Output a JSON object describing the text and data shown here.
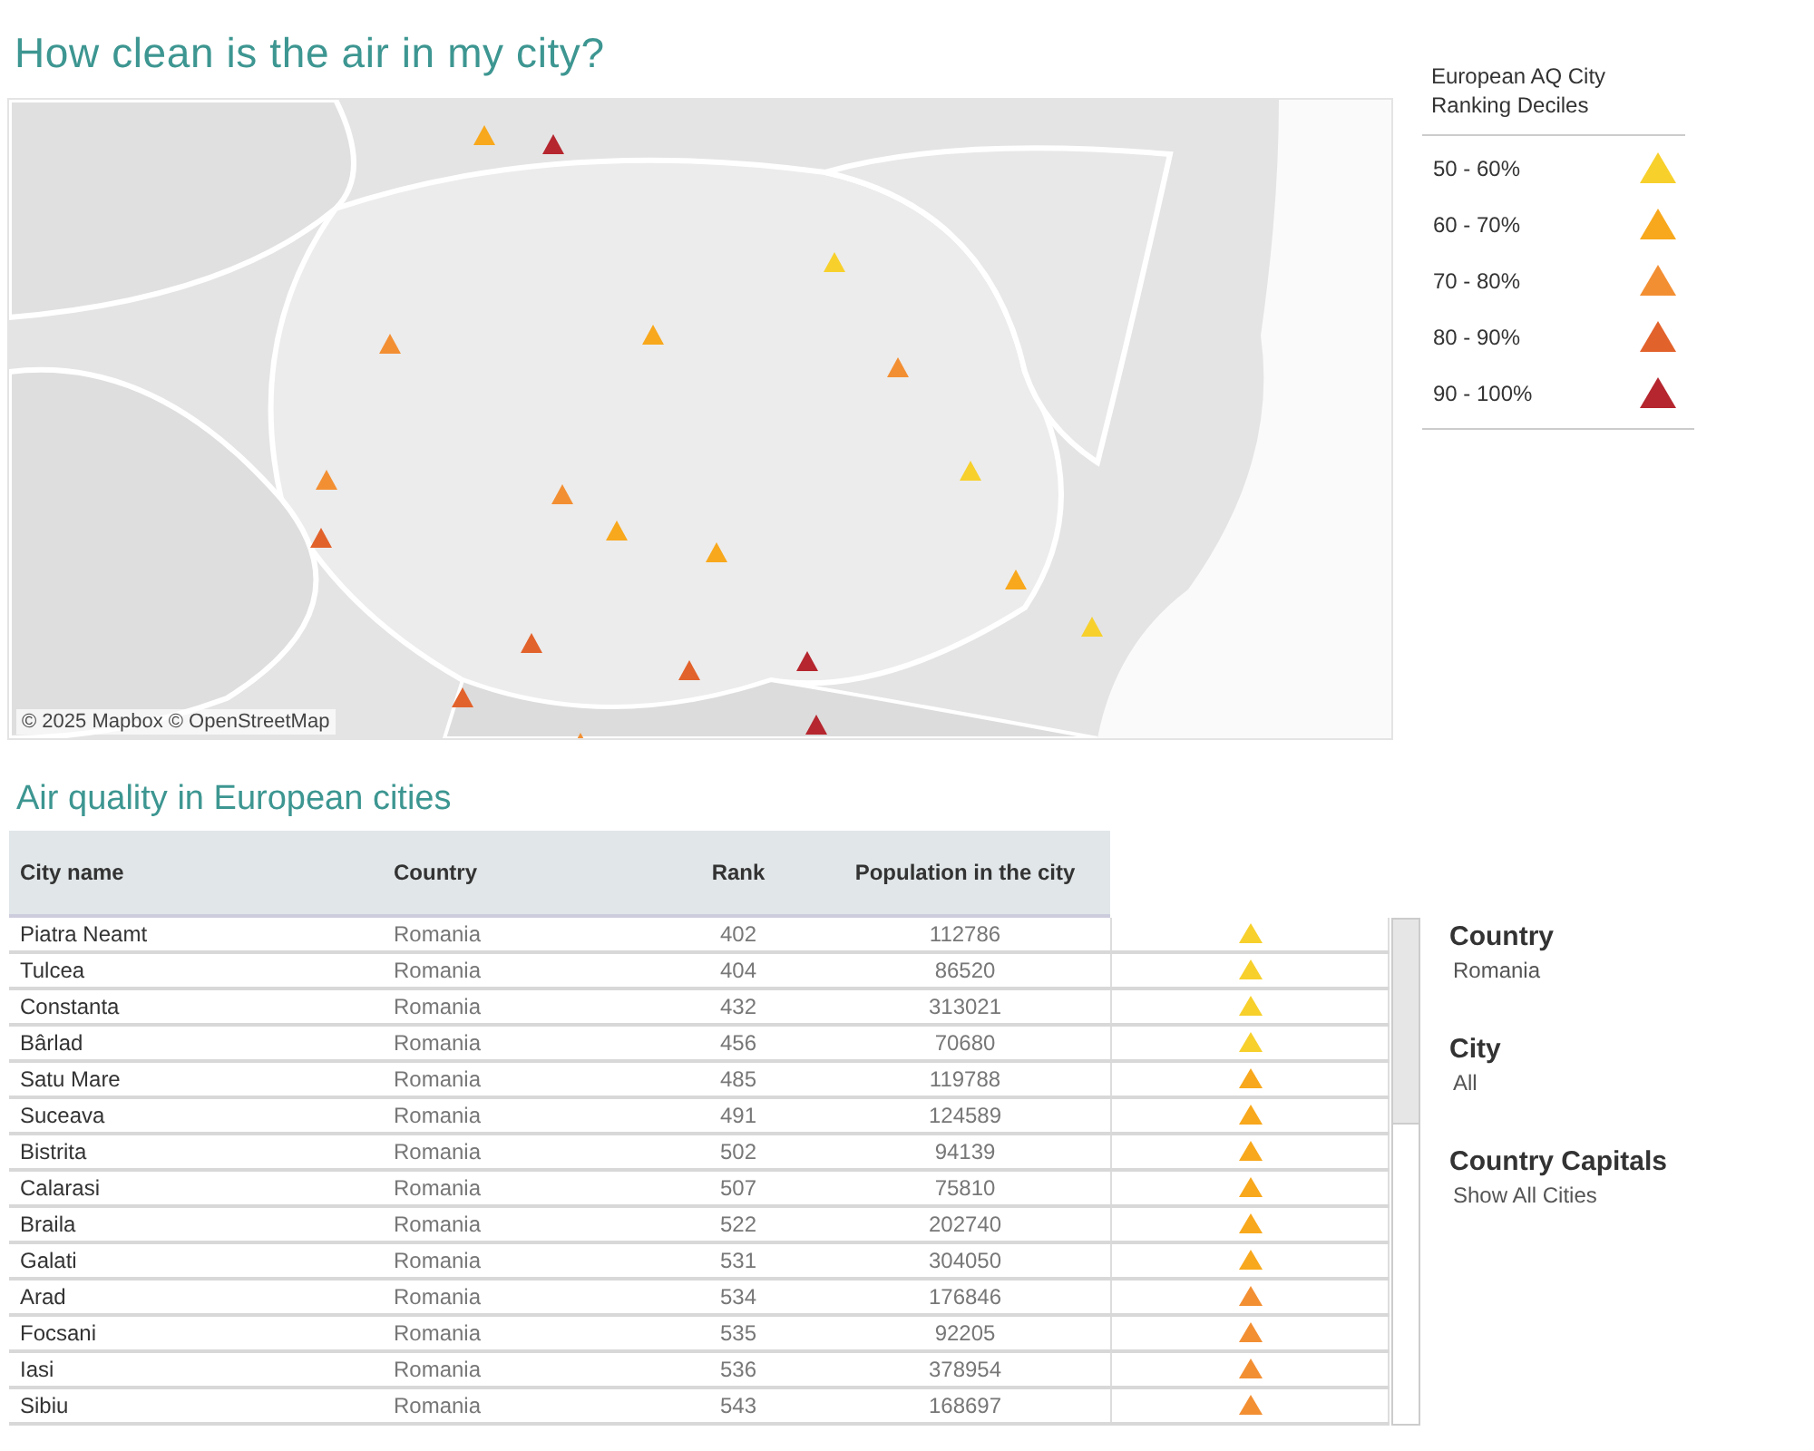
{
  "title": "How clean is the air in my city?",
  "map": {
    "attribution": "© 2025 Mapbox © OpenStreetMap"
  },
  "legend": {
    "title": "European AQ City Ranking Deciles",
    "items": [
      {
        "label": "50 - 60%",
        "color": "#f7d02c"
      },
      {
        "label": "60 - 70%",
        "color": "#f8a81c"
      },
      {
        "label": "70 - 80%",
        "color": "#f38f33"
      },
      {
        "label": "80 - 90%",
        "color": "#e2622b"
      },
      {
        "label": "90 - 100%",
        "color": "#b5262e"
      }
    ]
  },
  "table": {
    "title": "Air quality in European cities",
    "columns": [
      "City name",
      "Country",
      "Rank",
      "Population in the city"
    ],
    "rows": [
      {
        "cells": [
          "Piatra Neamt",
          "Romania",
          "402",
          "112786"
        ],
        "color": "#f7d02c"
      },
      {
        "cells": [
          "Tulcea",
          "Romania",
          "404",
          "86520"
        ],
        "color": "#f7d02c"
      },
      {
        "cells": [
          "Constanta",
          "Romania",
          "432",
          "313021"
        ],
        "color": "#f7d02c"
      },
      {
        "cells": [
          "Bârlad",
          "Romania",
          "456",
          "70680"
        ],
        "color": "#f7d02c"
      },
      {
        "cells": [
          "Satu Mare",
          "Romania",
          "485",
          "119788"
        ],
        "color": "#f8a81c"
      },
      {
        "cells": [
          "Suceava",
          "Romania",
          "491",
          "124589"
        ],
        "color": "#f8a81c"
      },
      {
        "cells": [
          "Bistrita",
          "Romania",
          "502",
          "94139"
        ],
        "color": "#f8a81c"
      },
      {
        "cells": [
          "Calarasi",
          "Romania",
          "507",
          "75810"
        ],
        "color": "#f8a81c"
      },
      {
        "cells": [
          "Braila",
          "Romania",
          "522",
          "202740"
        ],
        "color": "#f8a81c"
      },
      {
        "cells": [
          "Galati",
          "Romania",
          "531",
          "304050"
        ],
        "color": "#f8a81c"
      },
      {
        "cells": [
          "Arad",
          "Romania",
          "534",
          "176846"
        ],
        "color": "#f38f33"
      },
      {
        "cells": [
          "Focsani",
          "Romania",
          "535",
          "92205"
        ],
        "color": "#f38f33"
      },
      {
        "cells": [
          "Iasi",
          "Romania",
          "536",
          "378954"
        ],
        "color": "#f38f33"
      },
      {
        "cells": [
          "Sibiu",
          "Romania",
          "543",
          "168697"
        ],
        "color": "#f38f33"
      }
    ]
  },
  "filters": [
    {
      "label": "Country",
      "value": "Romania"
    },
    {
      "label": "City",
      "value": "All"
    },
    {
      "label": "Country Capitals",
      "value": "Show All Cities"
    }
  ]
}
